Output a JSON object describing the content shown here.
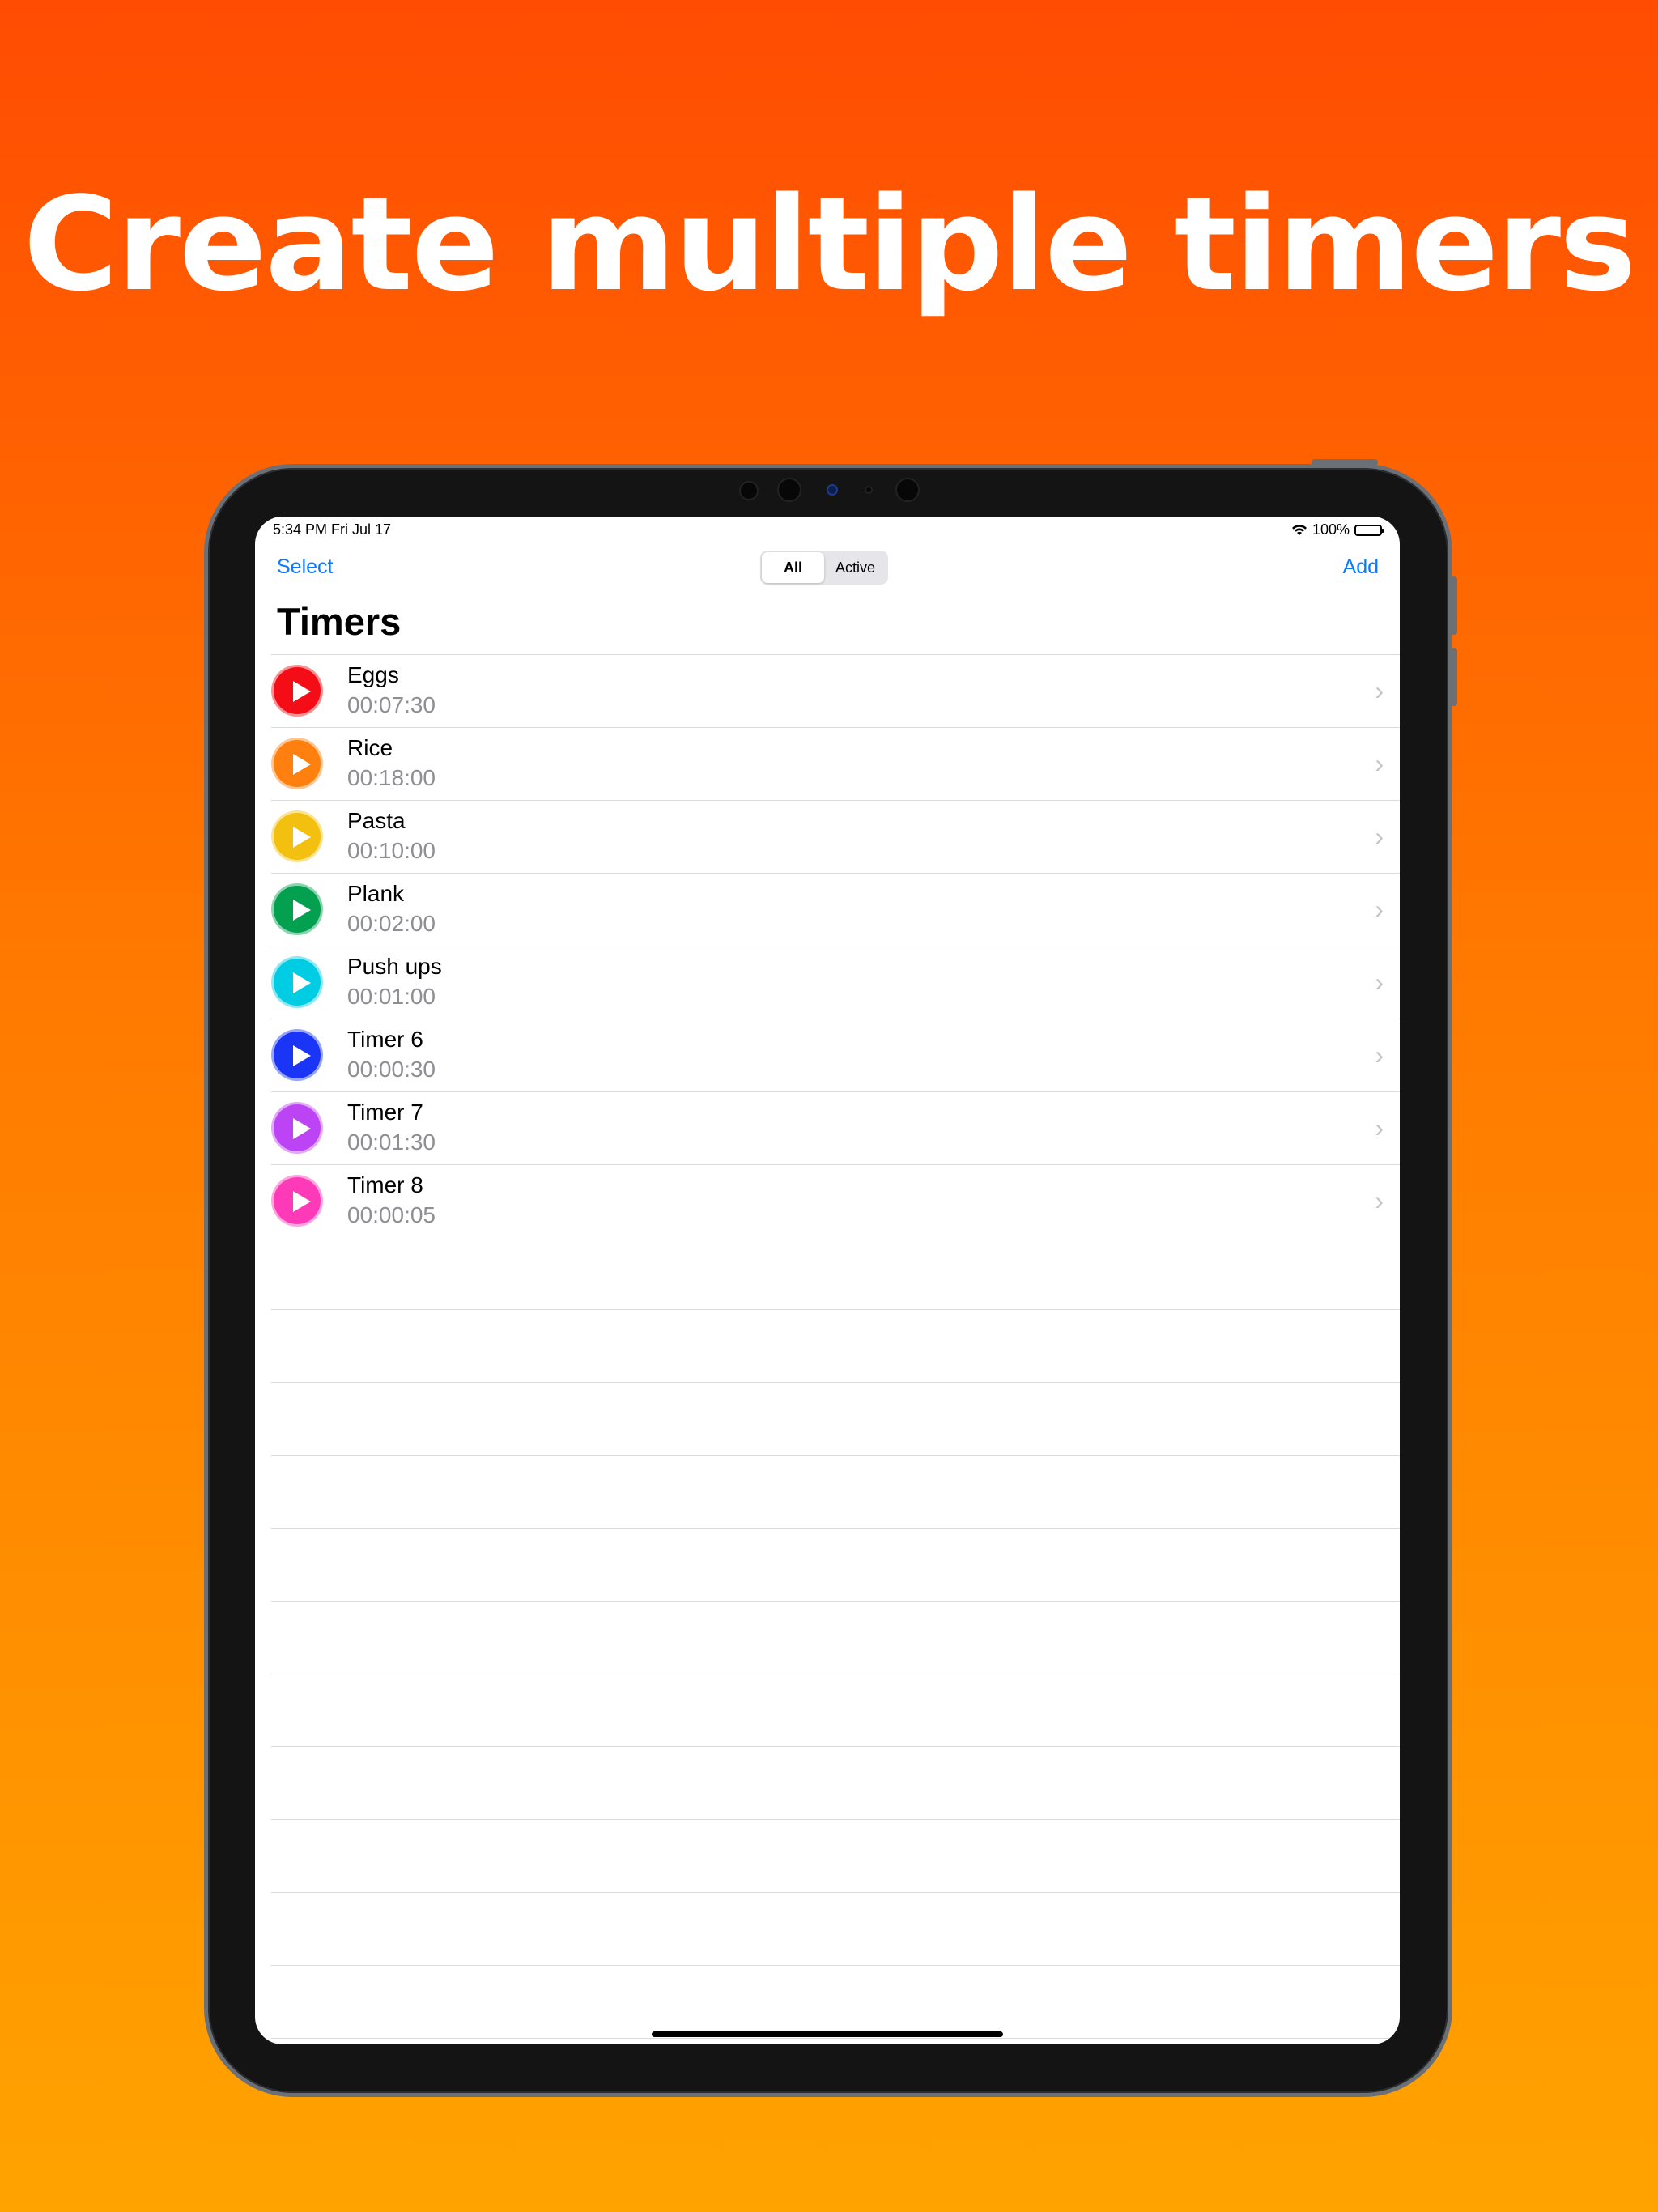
{
  "headline": "Create multiple timers",
  "status_bar": {
    "time": "5:34 PM   Fri Jul 17",
    "battery": "100%"
  },
  "nav": {
    "select_label": "Select",
    "add_label": "Add"
  },
  "segments": {
    "all": "All",
    "active": "Active",
    "selected": "All"
  },
  "title": "Timers",
  "timers": [
    {
      "name": "Eggs",
      "duration": "00:07:30",
      "color": "#f40c16"
    },
    {
      "name": "Rice",
      "duration": "00:18:00",
      "color": "#ff800e"
    },
    {
      "name": "Pasta",
      "duration": "00:10:00",
      "color": "#f3c00f"
    },
    {
      "name": "Plank",
      "duration": "00:02:00",
      "color": "#02a04f"
    },
    {
      "name": "Push ups",
      "duration": "00:01:00",
      "color": "#00cde4"
    },
    {
      "name": "Timer 6",
      "duration": "00:00:30",
      "color": "#1a35f6"
    },
    {
      "name": "Timer 7",
      "duration": "00:01:30",
      "color": "#bc44f4"
    },
    {
      "name": "Timer 8",
      "duration": "00:00:05",
      "color": "#ff3ab9"
    }
  ],
  "icons": {
    "play": "play-icon",
    "chevron": "chevron-right-icon",
    "wifi": "wifi-icon",
    "battery": "battery-icon"
  }
}
